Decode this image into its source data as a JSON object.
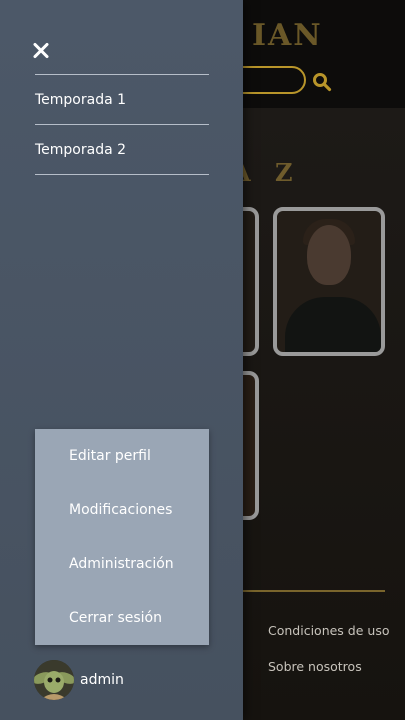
{
  "background": {
    "logo_text": "IAN",
    "heading": "A Z",
    "footer": {
      "terms_label": "Condiciones de uso",
      "about_label": "Sobre nosotros"
    }
  },
  "drawer": {
    "seasons": [
      {
        "label": "Temporada 1"
      },
      {
        "label": "Temporada 2"
      }
    ],
    "user_menu": [
      {
        "label": "Editar perfil"
      },
      {
        "label": "Modificaciones"
      },
      {
        "label": "Administración"
      },
      {
        "label": "Cerrar sesión"
      }
    ],
    "user": {
      "name": "admin"
    }
  },
  "colors": {
    "drawer": "#4c5868",
    "menu": "#9aa6b5",
    "accent": "#b8952a"
  },
  "icons": [
    "close-icon",
    "search-icon",
    "avatar"
  ]
}
